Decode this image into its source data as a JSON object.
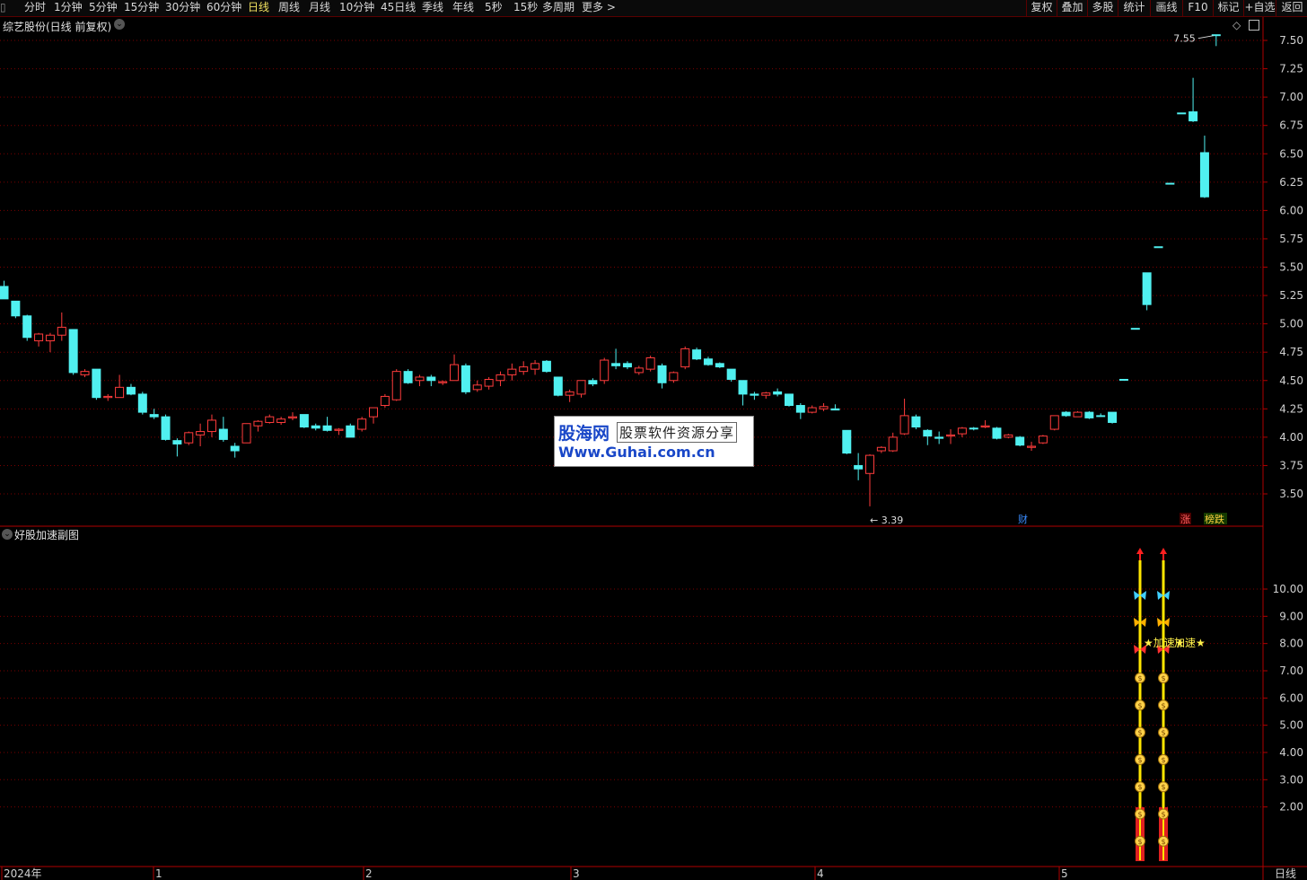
{
  "toolbar": {
    "periods": [
      "分时",
      "1分钟",
      "5分钟",
      "15分钟",
      "30分钟",
      "60分钟",
      "日线",
      "周线",
      "月线",
      "10分钟",
      "45日线",
      "季线",
      "年线",
      "5秒",
      "15秒",
      "多周期",
      "更多 >"
    ],
    "active": "日线",
    "right_buttons": [
      "复权",
      "叠加",
      "多股",
      "统计",
      "画线",
      "F10",
      "标记",
      "+自选",
      "返回"
    ]
  },
  "main_chart": {
    "title": "综艺股份(日线 前复权)",
    "price_labels": [
      "7.50",
      "7.25",
      "7.00",
      "6.75",
      "6.50",
      "6.25",
      "6.00",
      "5.75",
      "5.50",
      "5.25",
      "5.00",
      "4.75",
      "4.50",
      "4.25",
      "4.00",
      "3.75",
      "3.50"
    ],
    "high_marker": "7.55",
    "low_marker": "3.39",
    "event_tags": [
      "财",
      "涨",
      "榜跌"
    ],
    "colors": {
      "up": "#ff3c3c",
      "down": "#50f0f0",
      "grid": "#7a0000",
      "axis": "#b00000"
    }
  },
  "sub_chart": {
    "title": "好股加速副图",
    "value_labels": [
      "10.00",
      "9.00",
      "8.00",
      "7.00",
      "6.00",
      "5.00",
      "4.00",
      "3.00",
      "2.00"
    ],
    "signal_text": "★加速★",
    "signal_text_2": "加速★"
  },
  "time_axis": {
    "labels": [
      "2024年",
      "1",
      "2",
      "3",
      "4",
      "5"
    ],
    "period": "日线"
  },
  "watermark": {
    "logo": "股海网",
    "slogan": "股票软件资源分享",
    "url": "Www.Guhai.com.cn"
  },
  "candles": [
    {
      "o": 5.33,
      "h": 5.38,
      "l": 5.22,
      "c": 5.22
    },
    {
      "o": 5.2,
      "h": 5.2,
      "l": 5.05,
      "c": 5.07
    },
    {
      "o": 5.07,
      "h": 5.08,
      "l": 4.85,
      "c": 4.88
    },
    {
      "o": 4.85,
      "h": 4.92,
      "l": 4.8,
      "c": 4.91
    },
    {
      "o": 4.85,
      "h": 4.92,
      "l": 4.75,
      "c": 4.9
    },
    {
      "o": 4.9,
      "h": 5.1,
      "l": 4.85,
      "c": 4.97
    },
    {
      "o": 4.95,
      "h": 4.95,
      "l": 4.55,
      "c": 4.57
    },
    {
      "o": 4.55,
      "h": 4.6,
      "l": 4.53,
      "c": 4.58
    },
    {
      "o": 4.6,
      "h": 4.6,
      "l": 4.33,
      "c": 4.35
    },
    {
      "o": 4.35,
      "h": 4.38,
      "l": 4.32,
      "c": 4.36
    },
    {
      "o": 4.35,
      "h": 4.55,
      "l": 4.35,
      "c": 4.44
    },
    {
      "o": 4.44,
      "h": 4.47,
      "l": 4.37,
      "c": 4.38
    },
    {
      "o": 4.38,
      "h": 4.4,
      "l": 4.2,
      "c": 4.22
    },
    {
      "o": 4.2,
      "h": 4.25,
      "l": 4.16,
      "c": 4.18
    },
    {
      "o": 4.18,
      "h": 4.2,
      "l": 3.97,
      "c": 3.98
    },
    {
      "o": 3.97,
      "h": 3.99,
      "l": 3.83,
      "c": 3.94
    },
    {
      "o": 3.95,
      "h": 4.05,
      "l": 3.93,
      "c": 4.04
    },
    {
      "o": 4.02,
      "h": 4.12,
      "l": 3.92,
      "c": 4.05
    },
    {
      "o": 4.05,
      "h": 4.2,
      "l": 4.0,
      "c": 4.15
    },
    {
      "o": 4.07,
      "h": 4.18,
      "l": 3.96,
      "c": 3.98
    },
    {
      "o": 3.92,
      "h": 3.95,
      "l": 3.82,
      "c": 3.88
    },
    {
      "o": 3.95,
      "h": 4.12,
      "l": 3.95,
      "c": 4.12
    },
    {
      "o": 4.1,
      "h": 4.15,
      "l": 4.05,
      "c": 4.14
    },
    {
      "o": 4.13,
      "h": 4.2,
      "l": 4.12,
      "c": 4.18
    },
    {
      "o": 4.13,
      "h": 4.18,
      "l": 4.11,
      "c": 4.16
    },
    {
      "o": 4.17,
      "h": 4.22,
      "l": 4.15,
      "c": 4.18
    },
    {
      "o": 4.2,
      "h": 4.2,
      "l": 4.08,
      "c": 4.09
    },
    {
      "o": 4.1,
      "h": 4.12,
      "l": 4.06,
      "c": 4.08
    },
    {
      "o": 4.1,
      "h": 4.18,
      "l": 4.05,
      "c": 4.06
    },
    {
      "o": 4.06,
      "h": 4.08,
      "l": 4.02,
      "c": 4.07
    },
    {
      "o": 4.1,
      "h": 4.12,
      "l": 4.0,
      "c": 4.0
    },
    {
      "o": 4.07,
      "h": 4.18,
      "l": 4.05,
      "c": 4.16
    },
    {
      "o": 4.18,
      "h": 4.26,
      "l": 4.12,
      "c": 4.26
    },
    {
      "o": 4.28,
      "h": 4.38,
      "l": 4.26,
      "c": 4.36
    },
    {
      "o": 4.33,
      "h": 4.6,
      "l": 4.32,
      "c": 4.58
    },
    {
      "o": 4.58,
      "h": 4.6,
      "l": 4.47,
      "c": 4.48
    },
    {
      "o": 4.5,
      "h": 4.55,
      "l": 4.45,
      "c": 4.53
    },
    {
      "o": 4.53,
      "h": 4.55,
      "l": 4.45,
      "c": 4.5
    },
    {
      "o": 4.48,
      "h": 4.5,
      "l": 4.46,
      "c": 4.49
    },
    {
      "o": 4.5,
      "h": 4.73,
      "l": 4.5,
      "c": 4.64
    },
    {
      "o": 4.63,
      "h": 4.65,
      "l": 4.38,
      "c": 4.4
    },
    {
      "o": 4.42,
      "h": 4.5,
      "l": 4.4,
      "c": 4.46
    },
    {
      "o": 4.45,
      "h": 4.53,
      "l": 4.42,
      "c": 4.51
    },
    {
      "o": 4.5,
      "h": 4.58,
      "l": 4.45,
      "c": 4.55
    },
    {
      "o": 4.55,
      "h": 4.65,
      "l": 4.5,
      "c": 4.6
    },
    {
      "o": 4.58,
      "h": 4.67,
      "l": 4.55,
      "c": 4.62
    },
    {
      "o": 4.6,
      "h": 4.68,
      "l": 4.55,
      "c": 4.65
    },
    {
      "o": 4.67,
      "h": 4.68,
      "l": 4.57,
      "c": 4.58
    },
    {
      "o": 4.53,
      "h": 4.53,
      "l": 4.36,
      "c": 4.37
    },
    {
      "o": 4.37,
      "h": 4.42,
      "l": 4.31,
      "c": 4.4
    },
    {
      "o": 4.38,
      "h": 4.5,
      "l": 4.35,
      "c": 4.5
    },
    {
      "o": 4.5,
      "h": 4.52,
      "l": 4.45,
      "c": 4.47
    },
    {
      "o": 4.5,
      "h": 4.7,
      "l": 4.47,
      "c": 4.68
    },
    {
      "o": 4.65,
      "h": 4.78,
      "l": 4.6,
      "c": 4.63
    },
    {
      "o": 4.65,
      "h": 4.67,
      "l": 4.6,
      "c": 4.62
    },
    {
      "o": 4.57,
      "h": 4.63,
      "l": 4.55,
      "c": 4.61
    },
    {
      "o": 4.6,
      "h": 4.72,
      "l": 4.58,
      "c": 4.7
    },
    {
      "o": 4.63,
      "h": 4.65,
      "l": 4.43,
      "c": 4.48
    },
    {
      "o": 4.5,
      "h": 4.58,
      "l": 4.48,
      "c": 4.57
    },
    {
      "o": 4.62,
      "h": 4.8,
      "l": 4.6,
      "c": 4.78
    },
    {
      "o": 4.77,
      "h": 4.79,
      "l": 4.68,
      "c": 4.69
    },
    {
      "o": 4.69,
      "h": 4.71,
      "l": 4.63,
      "c": 4.64
    },
    {
      "o": 4.65,
      "h": 4.66,
      "l": 4.61,
      "c": 4.62
    },
    {
      "o": 4.6,
      "h": 4.6,
      "l": 4.49,
      "c": 4.51
    },
    {
      "o": 4.5,
      "h": 4.5,
      "l": 4.28,
      "c": 4.38
    },
    {
      "o": 4.38,
      "h": 4.4,
      "l": 4.33,
      "c": 4.37
    },
    {
      "o": 4.37,
      "h": 4.4,
      "l": 4.34,
      "c": 4.39
    },
    {
      "o": 4.4,
      "h": 4.43,
      "l": 4.36,
      "c": 4.38
    },
    {
      "o": 4.38,
      "h": 4.38,
      "l": 4.27,
      "c": 4.28
    },
    {
      "o": 4.28,
      "h": 4.3,
      "l": 4.16,
      "c": 4.22
    },
    {
      "o": 4.22,
      "h": 4.28,
      "l": 4.21,
      "c": 4.26
    },
    {
      "o": 4.25,
      "h": 4.3,
      "l": 4.23,
      "c": 4.27
    },
    {
      "o": 4.25,
      "h": 4.29,
      "l": 4.24,
      "c": 4.24
    },
    {
      "o": 4.06,
      "h": 4.06,
      "l": 3.85,
      "c": 3.86
    },
    {
      "o": 3.75,
      "h": 3.86,
      "l": 3.62,
      "c": 3.72
    },
    {
      "o": 3.68,
      "h": 3.85,
      "l": 3.39,
      "c": 3.84
    },
    {
      "o": 3.88,
      "h": 3.92,
      "l": 3.86,
      "c": 3.91
    },
    {
      "o": 3.88,
      "h": 4.04,
      "l": 3.87,
      "c": 4.0
    },
    {
      "o": 4.03,
      "h": 4.34,
      "l": 4.02,
      "c": 4.19
    },
    {
      "o": 4.18,
      "h": 4.2,
      "l": 4.07,
      "c": 4.09
    },
    {
      "o": 4.06,
      "h": 4.07,
      "l": 3.93,
      "c": 4.01
    },
    {
      "o": 4.0,
      "h": 4.05,
      "l": 3.94,
      "c": 3.99
    },
    {
      "o": 4.01,
      "h": 4.07,
      "l": 3.94,
      "c": 4.02
    },
    {
      "o": 4.03,
      "h": 4.09,
      "l": 4.0,
      "c": 4.08
    },
    {
      "o": 4.08,
      "h": 4.09,
      "l": 4.06,
      "c": 4.08
    },
    {
      "o": 4.09,
      "h": 4.15,
      "l": 4.08,
      "c": 4.1
    },
    {
      "o": 4.08,
      "h": 4.09,
      "l": 3.98,
      "c": 3.99
    },
    {
      "o": 4.0,
      "h": 4.03,
      "l": 3.99,
      "c": 4.02
    },
    {
      "o": 4.0,
      "h": 4.01,
      "l": 3.92,
      "c": 3.93
    },
    {
      "o": 3.91,
      "h": 3.96,
      "l": 3.88,
      "c": 3.92
    },
    {
      "o": 3.95,
      "h": 4.02,
      "l": 3.94,
      "c": 4.01
    },
    {
      "o": 4.07,
      "h": 4.19,
      "l": 4.06,
      "c": 4.19
    },
    {
      "o": 4.22,
      "h": 4.23,
      "l": 4.18,
      "c": 4.19
    },
    {
      "o": 4.18,
      "h": 4.23,
      "l": 4.18,
      "c": 4.22
    },
    {
      "o": 4.22,
      "h": 4.23,
      "l": 4.16,
      "c": 4.17
    },
    {
      "o": 4.19,
      "h": 4.21,
      "l": 4.18,
      "c": 4.19
    },
    {
      "o": 4.22,
      "h": 4.22,
      "l": 4.12,
      "c": 4.13
    },
    {
      "o": 4.51,
      "h": 4.51,
      "l": 4.51,
      "c": 4.51
    },
    {
      "o": 4.96,
      "h": 4.96,
      "l": 4.96,
      "c": 4.96
    },
    {
      "o": 5.45,
      "h": 5.45,
      "l": 5.12,
      "c": 5.17
    },
    {
      "o": 5.68,
      "h": 5.68,
      "l": 5.68,
      "c": 5.68
    },
    {
      "o": 6.24,
      "h": 6.24,
      "l": 6.24,
      "c": 6.24
    },
    {
      "o": 6.86,
      "h": 6.86,
      "l": 6.86,
      "c": 6.86
    },
    {
      "o": 6.87,
      "h": 7.17,
      "l": 6.78,
      "c": 6.79
    },
    {
      "o": 6.51,
      "h": 6.66,
      "l": 6.11,
      "c": 6.12
    },
    {
      "o": 7.55,
      "h": 7.55,
      "l": 7.45,
      "c": 7.55
    }
  ]
}
